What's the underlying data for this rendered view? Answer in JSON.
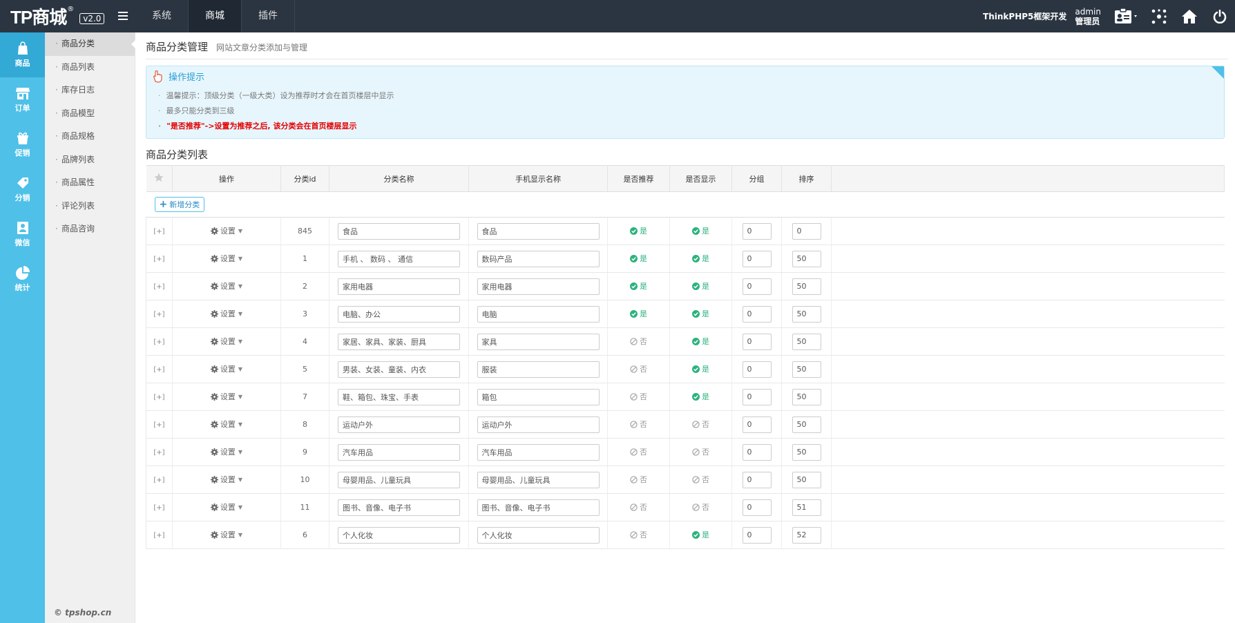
{
  "logo": {
    "text": "TP商城",
    "mark": "®",
    "version": "v2.0"
  },
  "topnav": [
    {
      "label": "系统"
    },
    {
      "label": "商城"
    },
    {
      "label": "插件"
    }
  ],
  "top_right": {
    "framework": "ThinkPHP5框架开发",
    "user": "admin",
    "role": "管理员"
  },
  "iconbar": [
    {
      "label": "商品",
      "icon": "bag-icon"
    },
    {
      "label": "订单",
      "icon": "store-icon"
    },
    {
      "label": "促销",
      "icon": "promo-icon"
    },
    {
      "label": "分销",
      "icon": "share-icon"
    },
    {
      "label": "微信",
      "icon": "wechat-icon"
    },
    {
      "label": "统计",
      "icon": "pie-icon"
    }
  ],
  "subnav": [
    {
      "label": "商品分类"
    },
    {
      "label": "商品列表"
    },
    {
      "label": "库存日志"
    },
    {
      "label": "商品模型"
    },
    {
      "label": "商品规格"
    },
    {
      "label": "品牌列表"
    },
    {
      "label": "商品属性"
    },
    {
      "label": "评论列表"
    },
    {
      "label": "商品咨询"
    }
  ],
  "copyright": "© tpshop.cn",
  "page": {
    "title": "商品分类管理",
    "subtitle": "网站文章分类添加与管理"
  },
  "tips": {
    "title": "操作提示",
    "lines": [
      "温馨提示：顶级分类（一级大类）设为推荐时才会在首页楼层中显示",
      "最多只能分类到三级",
      "\"是否推荐\"->设置为推荐之后, 该分类会在首页楼层显示"
    ]
  },
  "list_title": "商品分类列表",
  "table": {
    "headers": [
      "操作",
      "分类id",
      "分类名称",
      "手机显示名称",
      "是否推荐",
      "是否显示",
      "分组",
      "排序"
    ],
    "add_label": "新增分类",
    "expand_label": "[+]",
    "setting_label": "设置",
    "yes_label": "是",
    "no_label": "否",
    "rows": [
      {
        "id": "845",
        "name": "食品",
        "mobile": "食品",
        "recommend": true,
        "show": true,
        "group": "0",
        "sort": "0"
      },
      {
        "id": "1",
        "name": "手机 、 数码 、 通信",
        "mobile": "数码产品",
        "recommend": true,
        "show": true,
        "group": "0",
        "sort": "50"
      },
      {
        "id": "2",
        "name": "家用电器",
        "mobile": "家用电器",
        "recommend": true,
        "show": true,
        "group": "0",
        "sort": "50"
      },
      {
        "id": "3",
        "name": "电脑、办公",
        "mobile": "电脑",
        "recommend": true,
        "show": true,
        "group": "0",
        "sort": "50"
      },
      {
        "id": "4",
        "name": "家居、家具、家装、厨具",
        "mobile": "家具",
        "recommend": false,
        "show": true,
        "group": "0",
        "sort": "50"
      },
      {
        "id": "5",
        "name": "男装、女装、童装、内衣",
        "mobile": "服装",
        "recommend": false,
        "show": true,
        "group": "0",
        "sort": "50"
      },
      {
        "id": "7",
        "name": "鞋、箱包、珠宝、手表",
        "mobile": "箱包",
        "recommend": false,
        "show": true,
        "group": "0",
        "sort": "50"
      },
      {
        "id": "8",
        "name": "运动户外",
        "mobile": "运动户外",
        "recommend": false,
        "show": false,
        "group": "0",
        "sort": "50"
      },
      {
        "id": "9",
        "name": "汽车用品",
        "mobile": "汽车用品",
        "recommend": false,
        "show": false,
        "group": "0",
        "sort": "50"
      },
      {
        "id": "10",
        "name": "母婴用品、儿童玩具",
        "mobile": "母婴用品、儿童玩具",
        "recommend": false,
        "show": false,
        "group": "0",
        "sort": "50"
      },
      {
        "id": "11",
        "name": "图书、音像、电子书",
        "mobile": "图书、音像、电子书",
        "recommend": false,
        "show": false,
        "group": "0",
        "sort": "51"
      },
      {
        "id": "6",
        "name": "个人化妆",
        "mobile": "个人化妆",
        "recommend": false,
        "show": true,
        "group": "0",
        "sort": "52"
      }
    ]
  },
  "colors": {
    "topbar": "#2b3542",
    "sidebar": "#4fc0e8",
    "yes": "#2db27d",
    "alert": "#e30000"
  }
}
